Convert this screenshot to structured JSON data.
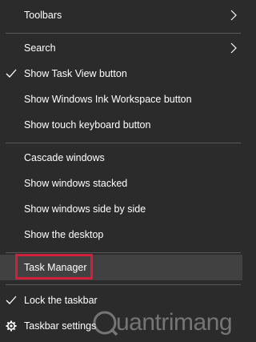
{
  "menu": {
    "items": [
      {
        "label": "Toolbars"
      },
      {
        "label": "Search"
      },
      {
        "label": "Show Task View button"
      },
      {
        "label": "Show Windows Ink Workspace button"
      },
      {
        "label": "Show touch keyboard button"
      },
      {
        "label": "Cascade windows"
      },
      {
        "label": "Show windows stacked"
      },
      {
        "label": "Show windows side by side"
      },
      {
        "label": "Show the desktop"
      },
      {
        "label": "Task Manager"
      },
      {
        "label": "Lock the taskbar"
      },
      {
        "label": "Taskbar settings"
      }
    ]
  },
  "watermark": {
    "text": "uantrimang"
  },
  "colors": {
    "background": "#2b2b2b",
    "highlight": "#414141",
    "callout_border": "#d0203a",
    "text": "#ffffff"
  }
}
